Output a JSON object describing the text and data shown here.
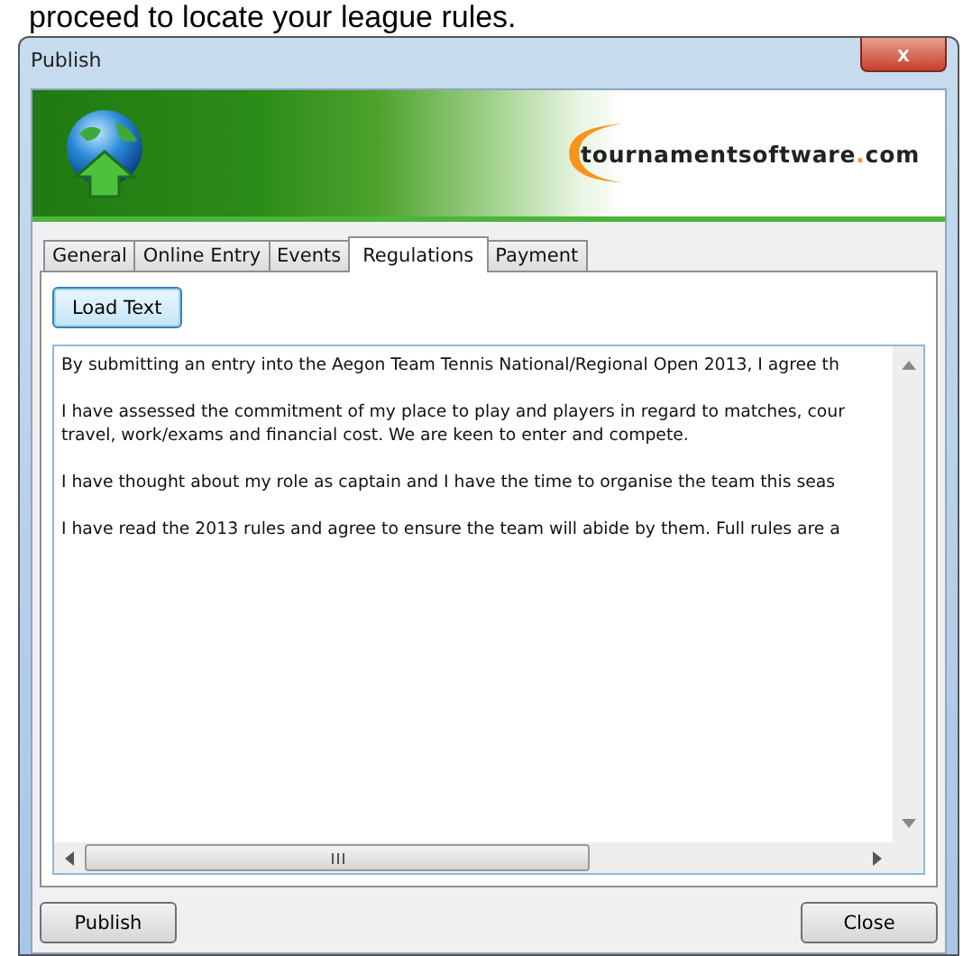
{
  "caption": "proceed to locate your league rules.",
  "window": {
    "title": "Publish",
    "close": "x"
  },
  "banner": {
    "logo_text": "tournamentsoftware",
    "logo_dot": ".",
    "logo_suffix": "com"
  },
  "tabs": [
    {
      "label": "General",
      "selected": false
    },
    {
      "label": "Online Entry",
      "selected": false
    },
    {
      "label": "Events",
      "selected": false
    },
    {
      "label": "Regulations",
      "selected": true
    },
    {
      "label": "Payment",
      "selected": false
    }
  ],
  "load_button": "Load Text",
  "text_area": {
    "paragraphs": [
      [
        "By submitting an entry into the Aegon Team Tennis National/Regional Open 2013, I agree th"
      ],
      [
        "I have assessed the commitment of my place to play and players in regard to matches, cour",
        "travel, work/exams and financial cost. We are keen to enter and compete."
      ],
      [
        "I have thought about my role as captain and I have the time to organise the team this seas"
      ],
      [
        "I have read the 2013 rules and agree to ensure the team will abide by them. Full rules are a"
      ]
    ]
  },
  "buttons": [
    {
      "label": "Publish"
    },
    {
      "label": "Close"
    }
  ]
}
